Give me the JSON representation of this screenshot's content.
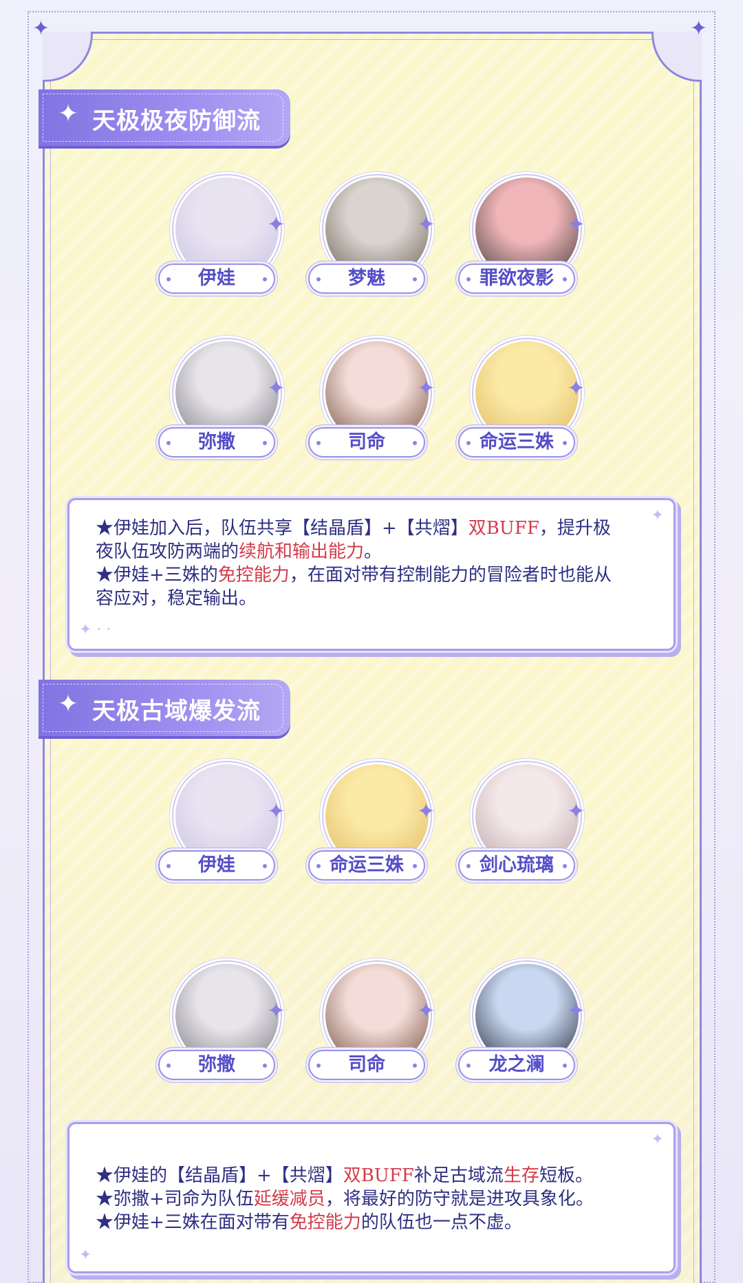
{
  "sections": [
    {
      "title": "天极极夜防御流",
      "characters": [
        {
          "name": "伊娃",
          "color_a": "#e9e4f2",
          "color_b": "#c9c2e2"
        },
        {
          "name": "梦魅",
          "color_a": "#d9d4cf",
          "color_b": "#6b5f53"
        },
        {
          "name": "罪欲夜影",
          "color_a": "#f0b5b8",
          "color_b": "#3d3838"
        },
        {
          "name": "弥撒",
          "color_a": "#e7e5ea",
          "color_b": "#7b7780"
        },
        {
          "name": "司命",
          "color_a": "#f4dcd8",
          "color_b": "#6d4b3a"
        },
        {
          "name": "命运三姝",
          "color_a": "#fbe9a6",
          "color_b": "#e0b860"
        }
      ],
      "description": [
        [
          {
            "t": "★伊娃加入后，队伍共享【结晶盾】+【共熠】"
          },
          {
            "t": "双BUFF",
            "red": true
          },
          {
            "t": "，提升极"
          }
        ],
        [
          {
            "t": "夜队伍攻防两端的"
          },
          {
            "t": "续航和输出能力",
            "red": true
          },
          {
            "t": "。"
          }
        ],
        [
          {
            "t": "★伊娃+三姝的"
          },
          {
            "t": "免控能力",
            "red": true
          },
          {
            "t": "，在面对带有控制能力的冒险者时也能从"
          }
        ],
        [
          {
            "t": "容应对，稳定输出。"
          }
        ]
      ]
    },
    {
      "title": "天极古域爆发流",
      "characters": [
        {
          "name": "伊娃",
          "color_a": "#e9e4f2",
          "color_b": "#c9c2e2"
        },
        {
          "name": "命运三姝",
          "color_a": "#fbe9a6",
          "color_b": "#e0b860"
        },
        {
          "name": "剑心琉璃",
          "color_a": "#f3e8ea",
          "color_b": "#b9a3a8"
        },
        {
          "name": "弥撒",
          "color_a": "#e7e5ea",
          "color_b": "#7b7780"
        },
        {
          "name": "司命",
          "color_a": "#f4dcd8",
          "color_b": "#6d4b3a"
        },
        {
          "name": "龙之澜",
          "color_a": "#c9d8f0",
          "color_b": "#1f2436"
        }
      ],
      "description": [
        [
          {
            "t": "★伊娃的【结晶盾】+【共熠】"
          },
          {
            "t": "双BUFF",
            "red": true
          },
          {
            "t": "补足古域流"
          },
          {
            "t": "生存",
            "red": true
          },
          {
            "t": "短板。"
          }
        ],
        [
          {
            "t": "★弥撒+司命为队伍"
          },
          {
            "t": "延缓减员",
            "red": true
          },
          {
            "t": "，将最好的防守就是进攻具象化。"
          }
        ],
        [
          {
            "t": "★伊娃+三姝在面对带有"
          },
          {
            "t": "免控能力",
            "red": true
          },
          {
            "t": "的队伍也一点不虚。"
          }
        ]
      ]
    }
  ],
  "icons": {
    "section": "sparkle-icon",
    "portrait_deco": "sparkle-icon"
  },
  "colors": {
    "accent": "#8173e2",
    "highlight_red": "#d33a4a",
    "text": "#2f2f83",
    "panel_bg": "#fbf6cc"
  }
}
